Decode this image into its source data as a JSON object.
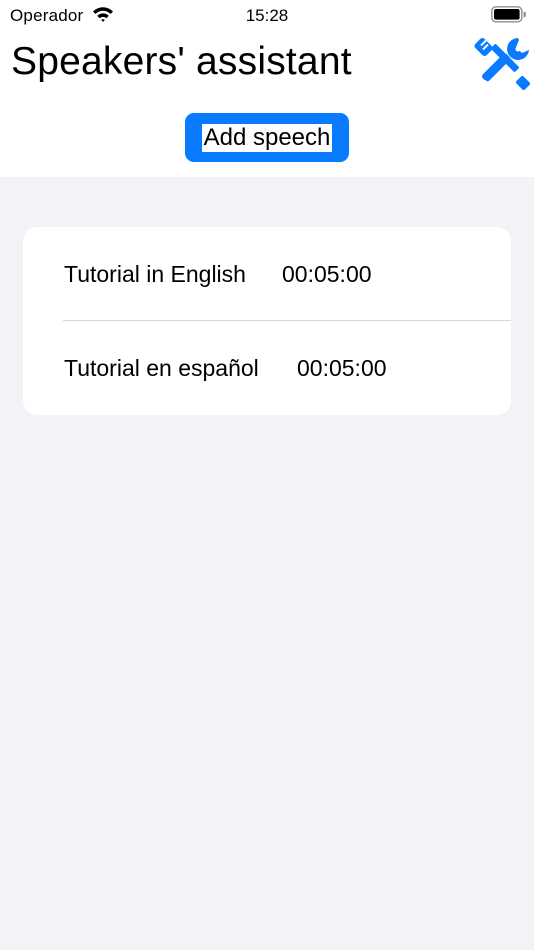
{
  "status_bar": {
    "carrier": "Operador",
    "time": "15:28"
  },
  "header": {
    "title": "Speakers' assistant",
    "tools_icon": "tools-icon",
    "add_button_label": "Add speech"
  },
  "speeches": [
    {
      "title": "Tutorial in English",
      "duration": "00:05:00"
    },
    {
      "title": "Tutorial en español",
      "duration": "00:05:00"
    }
  ],
  "colors": {
    "accent": "#0a7aff",
    "background": "#f2f2f7"
  }
}
